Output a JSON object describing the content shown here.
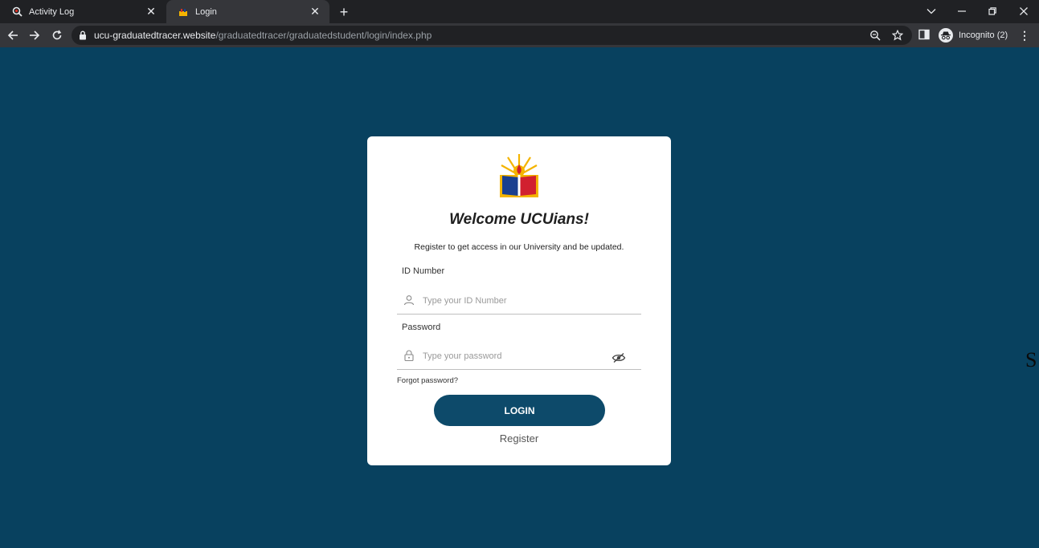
{
  "browser": {
    "tabs": [
      {
        "title": "Activity Log",
        "close": "✕"
      },
      {
        "title": "Login",
        "close": "✕"
      }
    ],
    "new_tab": "+",
    "url_host": "ucu-graduatedtracer.website",
    "url_path": "/graduatedtracer/graduatedstudent/login/index.php",
    "incognito_label": "Incognito (2)",
    "menu": "⋮"
  },
  "login": {
    "title": "Welcome UCUians!",
    "subtitle": "Register to get access in our University and be updated.",
    "id_label": "ID Number",
    "id_placeholder": "Type your ID Number",
    "password_label": "Password",
    "password_placeholder": "Type your password",
    "forgot": "Forgot password?",
    "login_button": "LOGIN",
    "register": "Register"
  },
  "edge_char": "S",
  "colors": {
    "page_background": "#08415f",
    "button": "#0d4a6a",
    "card": "#ffffff"
  }
}
